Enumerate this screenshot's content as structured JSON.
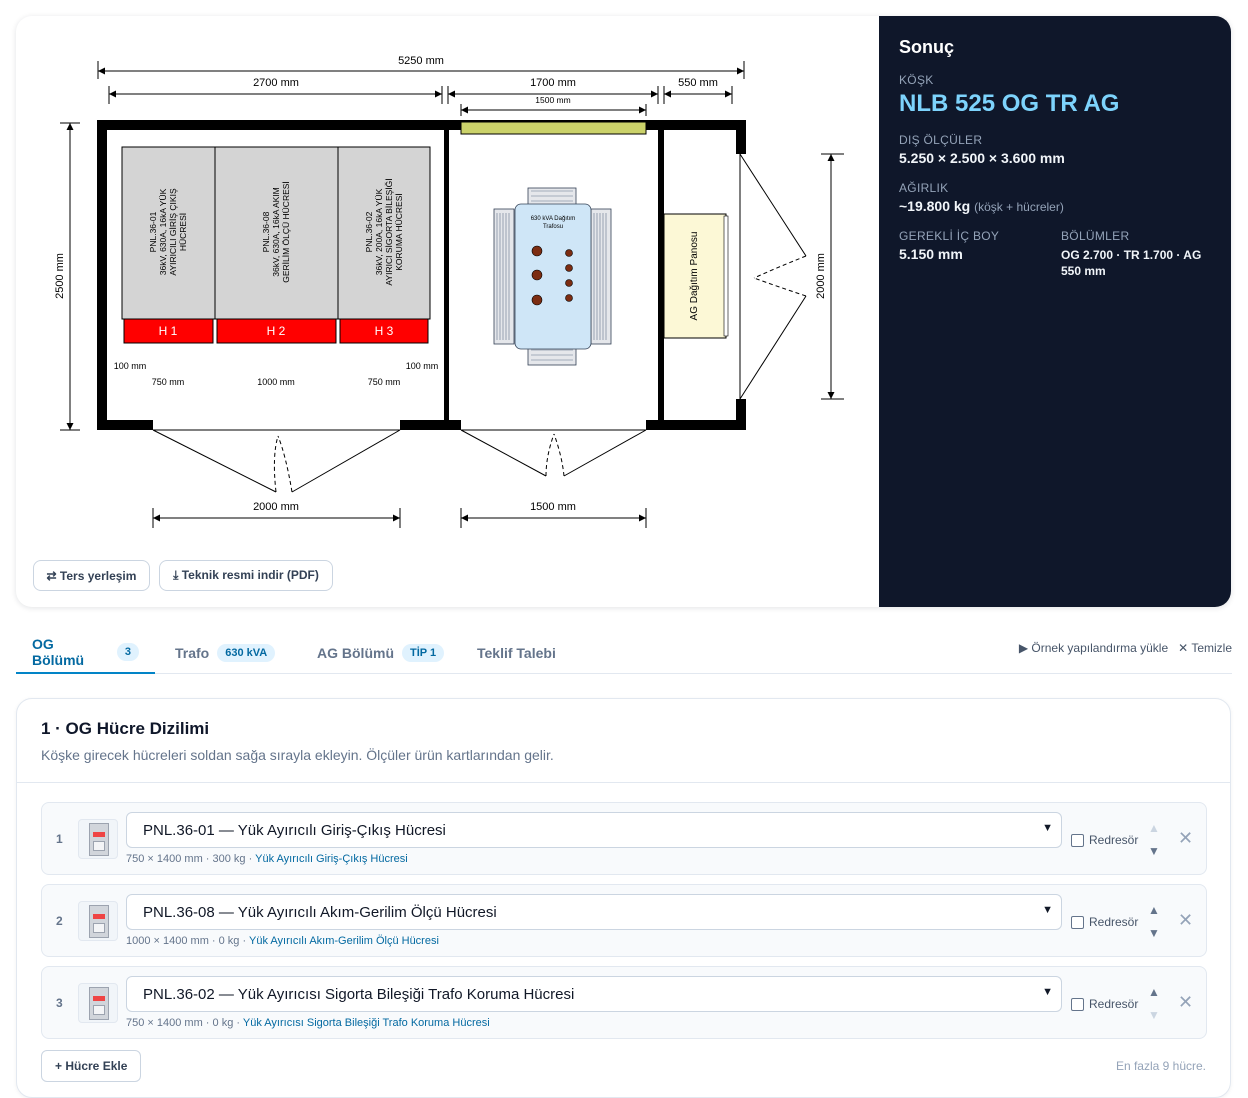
{
  "drawing": {
    "dims": {
      "total": "5250 mm",
      "og": "2700 mm",
      "tr": "1700 mm",
      "ag": "550 mm",
      "tr_inner": "1500 mm",
      "height": "2500 mm",
      "door_height": "2000 mm",
      "left_gap": "100 mm",
      "right_gap": "100 mm",
      "cell1_w": "750 mm",
      "cell2_w": "1000 mm",
      "cell3_w": "750 mm",
      "door_og": "2000 mm",
      "door_tr": "1500 mm"
    },
    "cells": [
      {
        "code": "H 1",
        "l1": "PNL.36-01",
        "l2": "36kV, 630A, 16kA YÜK",
        "l3": "AYIRICILI GİRİŞ ÇIKIŞ",
        "l4": "HÜCRESİ"
      },
      {
        "code": "H 2",
        "l1": "PNL.36-08",
        "l2": "36kV, 630A, 16kA AKIM",
        "l3": "GERİLİM ÖLÇÜ HÜCRESİ",
        "l4": ""
      },
      {
        "code": "H 3",
        "l1": "PNL.36-02",
        "l2": "36kV, 200A, 16kA YÜK",
        "l3": "AYIRICI SİGORTA BİLEŞİĞİ",
        "l4": "KORUMA HÜCRESİ"
      }
    ],
    "transformer_l1": "630 kVA Dağıtım",
    "transformer_l2": "Trafosu",
    "ag_panel": "AG Dağıtım Panosu"
  },
  "actions": {
    "reverse": "⇄ Ters yerleşim",
    "download": "⤓ Teknik resmi indir (PDF)"
  },
  "result": {
    "title": "Sonuç",
    "kiosk_label": "KÖŞK",
    "model": "NLB 525 OG TR AG",
    "dims_label": "DIŞ ÖLÇÜLER",
    "dims": "5.250 × 2.500 × 3.600 mm",
    "weight_label": "AĞIRLIK",
    "weight": "~19.800 kg",
    "weight_note": "(köşk + hücreler)",
    "length_label": "GEREKLİ İÇ BOY",
    "length": "5.150 mm",
    "sections_label": "BÖLÜMLER",
    "sections": "OG 2.700 · TR 1.700 · AG 550 mm"
  },
  "tabs": [
    {
      "label": "OG Bölümü",
      "badge": "3"
    },
    {
      "label": "Trafo",
      "badge": "630 kVA"
    },
    {
      "label": "AG Bölümü",
      "badge": "TİP 1"
    },
    {
      "label": "Teklif Talebi",
      "badge": ""
    }
  ],
  "tab_actions": {
    "load": "▶ Örnek yapılandırma yükle",
    "clear": "✕ Temizle"
  },
  "section": {
    "title": "1 · OG Hücre Dizilimi",
    "subtitle": "Köşke girecek hücreleri soldan sağa sırayla ekleyin. Ölçüler ürün kartlarından gelir.",
    "rows": [
      {
        "index": "1",
        "selected": "PNL.36-01 — Yük Ayırıcılı Giriş-Çıkış Hücresi",
        "meta": "750 × 1400 mm · 300 kg · ",
        "link": "Yük Ayırıcılı Giriş-Çıkış Hücresi",
        "check": "Redresör"
      },
      {
        "index": "2",
        "selected": "PNL.36-08 — Yük Ayırıcılı Akım-Gerilim Ölçü Hücresi",
        "meta": "1000 × 1400 mm · 0 kg · ",
        "link": "Yük Ayırıcılı Akım-Gerilim Ölçü Hücresi",
        "check": "Redresör"
      },
      {
        "index": "3",
        "selected": "PNL.36-02 — Yük Ayırıcısı Sigorta Bileşiği Trafo Koruma Hücresi",
        "meta": "750 × 1400 mm · 0 kg · ",
        "link": "Yük Ayırıcısı Sigorta Bileşiği Trafo Koruma Hücresi",
        "check": "Redresör"
      }
    ],
    "add": "+ Hücre Ekle",
    "limit": "En fazla 9 hücre."
  },
  "colors": {
    "accent": "#0284c7",
    "panel_bg": "#0f172a",
    "model_color": "#7dd3fc",
    "cell_red": "#ff0000",
    "vent_yellow": "#cbd26a"
  }
}
